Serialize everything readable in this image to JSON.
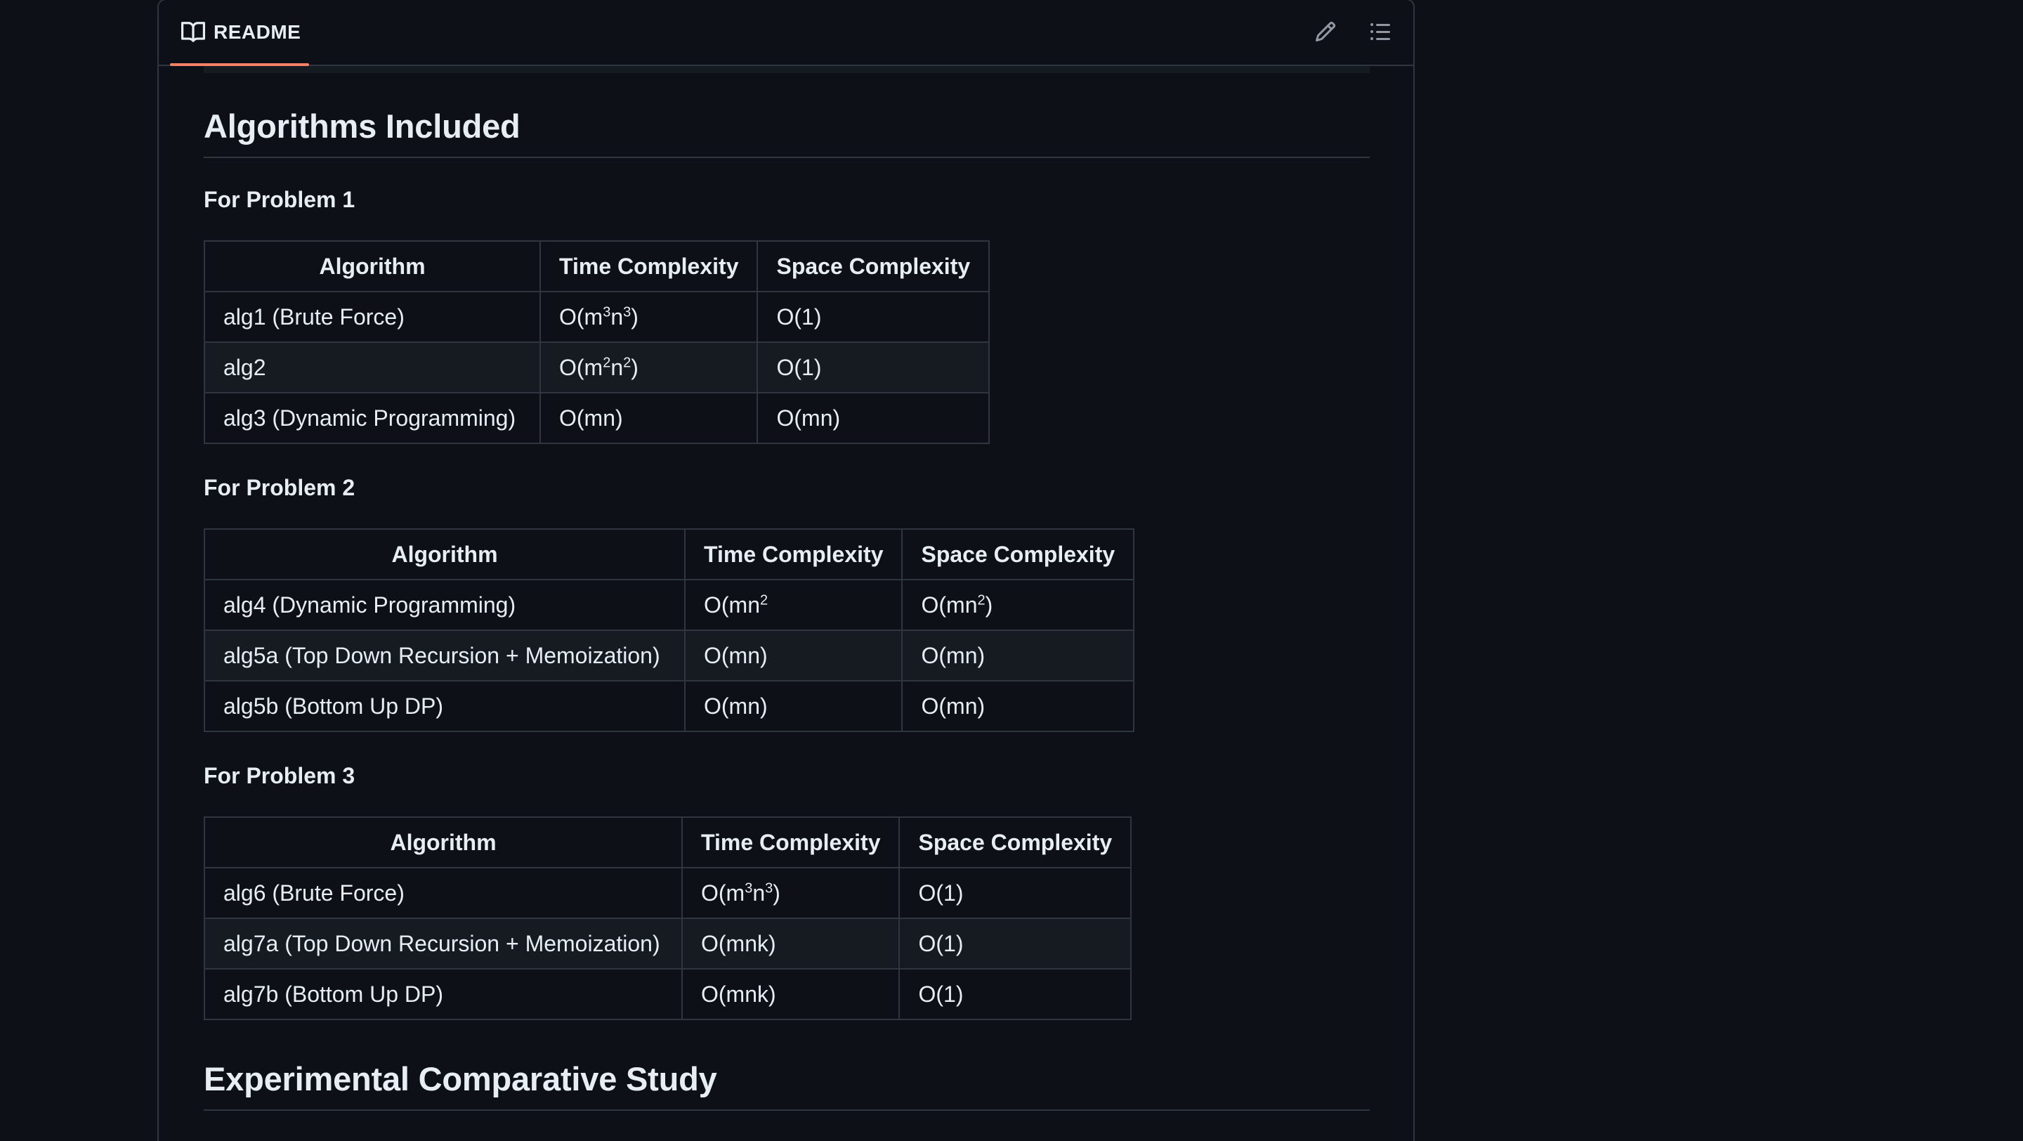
{
  "header": {
    "tab_label": "README",
    "icons": {
      "tab": "book-icon",
      "edit": "pencil-icon",
      "toc": "list-unordered-icon"
    }
  },
  "content": {
    "title": "Algorithms Included",
    "next_title": "Experimental Comparative Study",
    "problems": [
      {
        "heading": "For Problem 1",
        "columns": [
          "Algorithm",
          "Time Complexity",
          "Space Complexity"
        ],
        "rows": [
          {
            "algorithm": "alg1 (Brute Force)",
            "time": {
              "base": "O(m",
              "sup1": "3",
              "mid": "n",
              "sup2": "3",
              "end": ")"
            },
            "space": "O(1)"
          },
          {
            "algorithm": "alg2",
            "time": {
              "base": "O(m",
              "sup1": "2",
              "mid": "n",
              "sup2": "2",
              "end": ")"
            },
            "space": "O(1)"
          },
          {
            "algorithm": "alg3 (Dynamic Programming)",
            "time": {
              "base": "O(mn)"
            },
            "space": "O(mn)"
          }
        ]
      },
      {
        "heading": "For Problem 2",
        "columns": [
          "Algorithm",
          "Time Complexity",
          "Space Complexity"
        ],
        "rows": [
          {
            "algorithm": "alg4 (Dynamic Programming)",
            "time": {
              "base": "O(mn",
              "sup1": "2"
            },
            "space": {
              "base": "O(mn",
              "sup1": "2",
              "end": ")"
            }
          },
          {
            "algorithm": "alg5a (Top Down Recursion + Memoization)",
            "time": {
              "base": "O(mn)"
            },
            "space": "O(mn)"
          },
          {
            "algorithm": "alg5b (Bottom Up DP)",
            "time": {
              "base": "O(mn)"
            },
            "space": "O(mn)"
          }
        ]
      },
      {
        "heading": "For Problem 3",
        "columns": [
          "Algorithm",
          "Time Complexity",
          "Space Complexity"
        ],
        "rows": [
          {
            "algorithm": "alg6 (Brute Force)",
            "time": {
              "base": "O(m",
              "sup1": "3",
              "mid": "n",
              "sup2": "3",
              "end": ")"
            },
            "space": "O(1)"
          },
          {
            "algorithm": "alg7a (Top Down Recursion + Memoization)",
            "time": {
              "base": "O(mnk)"
            },
            "space": "O(1)"
          },
          {
            "algorithm": "alg7b (Bottom Up DP)",
            "time": {
              "base": "O(mnk)"
            },
            "space": "O(1)"
          }
        ]
      }
    ]
  },
  "colors": {
    "background": "#0d1117",
    "border": "#30363d",
    "alt_row": "#161b22",
    "text": "#e6edf3",
    "tab_underline": "#f78166"
  }
}
